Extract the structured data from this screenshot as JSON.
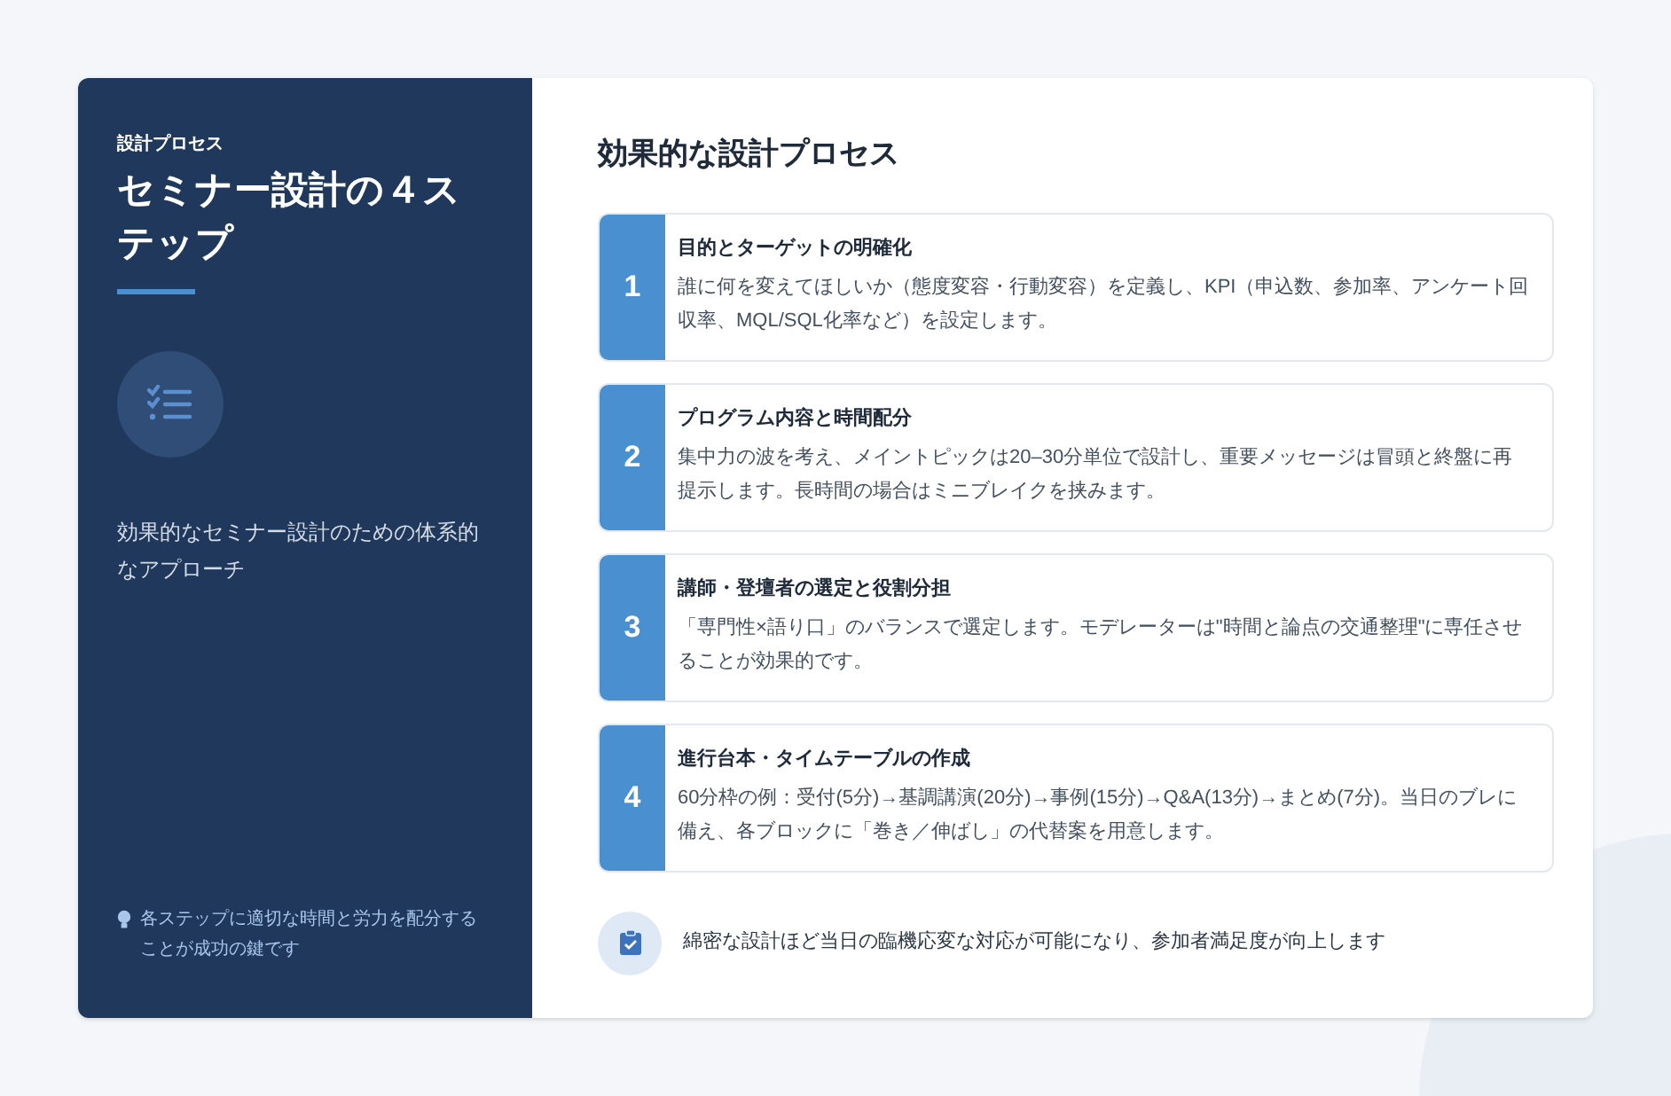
{
  "sidebar": {
    "eyebrow": "設計プロセス",
    "title": "セミナー設計の４ステップ",
    "description": "効果的なセミナー設計のための体系的なアプローチ",
    "tip": "各ステップに適切な時間と労力を配分することが成功の鍵です"
  },
  "main": {
    "heading": "効果的な設計プロセス",
    "steps": [
      {
        "number": "1",
        "title": "目的とターゲットの明確化",
        "body": "誰に何を変えてほしいか（態度変容・行動変容）を定義し、KPI（申込数、参加率、アンケート回収率、MQL/SQL化率など）を設定します。"
      },
      {
        "number": "2",
        "title": "プログラム内容と時間配分",
        "body": "集中力の波を考え、メイントピックは20–30分単位で設計し、重要メッセージは冒頭と終盤に再提示します。長時間の場合はミニブレイクを挟みます。"
      },
      {
        "number": "3",
        "title": "講師・登壇者の選定と役割分担",
        "body": "「専門性×語り口」のバランスで選定します。モデレーターは\"時間と論点の交通整理\"に専任させることが効果的です。"
      },
      {
        "number": "4",
        "title": "進行台本・タイムテーブルの作成",
        "body": "60分枠の例：受付(5分)→基調講演(20分)→事例(15分)→Q&A(13分)→まとめ(7分)。当日のブレに備え、各ブロックに「巻き／伸ばし」の代替案を用意します。"
      }
    ],
    "footer_note": "綿密な設計ほど当日の臨機応変な対応が可能になり、参加者満足度が向上します"
  }
}
